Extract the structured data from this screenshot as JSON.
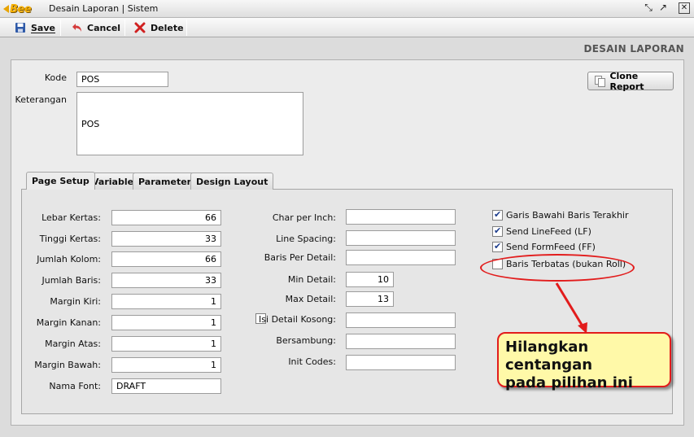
{
  "window": {
    "logo_text": "Bee",
    "title": "Desain Laporan | Sistem",
    "controls": [
      "restore",
      "maximize",
      "close"
    ]
  },
  "toolbar": {
    "save_label": "Save",
    "cancel_label": "Cancel",
    "delete_label": "Delete"
  },
  "heading": "DESAIN LAPORAN",
  "form": {
    "kode_label": "Kode",
    "kode_value": "POS",
    "keterangan_label": "Keterangan",
    "keterangan_value": "POS",
    "clone_button": "Clone Report"
  },
  "tabs": [
    {
      "label": "Page Setup",
      "active": true
    },
    {
      "label": "Variable",
      "active": false
    },
    {
      "label": "Parameter",
      "active": false
    },
    {
      "label": "Design Layout",
      "active": false
    }
  ],
  "page_setup": {
    "left": [
      {
        "label": "Lebar Kertas:",
        "value": "66"
      },
      {
        "label": "Tinggi Kertas:",
        "value": "33"
      },
      {
        "label": "Jumlah Kolom:",
        "value": "66"
      },
      {
        "label": "Jumlah Baris:",
        "value": "33"
      },
      {
        "label": "Margin Kiri:",
        "value": "1"
      },
      {
        "label": "Margin Kanan:",
        "value": "1"
      },
      {
        "label": "Margin Atas:",
        "value": "1"
      },
      {
        "label": "Margin Bawah:",
        "value": "1"
      },
      {
        "label": "Nama Font:",
        "value": "DRAFT"
      }
    ],
    "middle": [
      {
        "label": "Char per Inch:",
        "value": ""
      },
      {
        "label": "Line Spacing:",
        "value": ""
      },
      {
        "label": "Baris Per Detail:",
        "value": ""
      },
      {
        "label": "Min Detail:",
        "value": "10"
      },
      {
        "label": "Max Detail:",
        "value": "13"
      },
      {
        "label": "Isi Detail Kosong:",
        "value": "",
        "checked": false
      },
      {
        "label": "Bersambung:",
        "value": ""
      },
      {
        "label": "Init Codes:",
        "value": ""
      }
    ],
    "checks": [
      {
        "label": "Garis Bawahi Baris Terakhir",
        "checked": true
      },
      {
        "label": "Send LineFeed (LF)",
        "checked": true
      },
      {
        "label": "Send FormFeed (FF)",
        "checked": true
      },
      {
        "label": "Baris Terbatas (bukan Roll)",
        "checked": false
      }
    ]
  },
  "annotation": {
    "line1": "Hilangkan centangan",
    "line2": "pada pilihan ini",
    "color": "#e21c1c",
    "fill": "#fff9a8"
  }
}
